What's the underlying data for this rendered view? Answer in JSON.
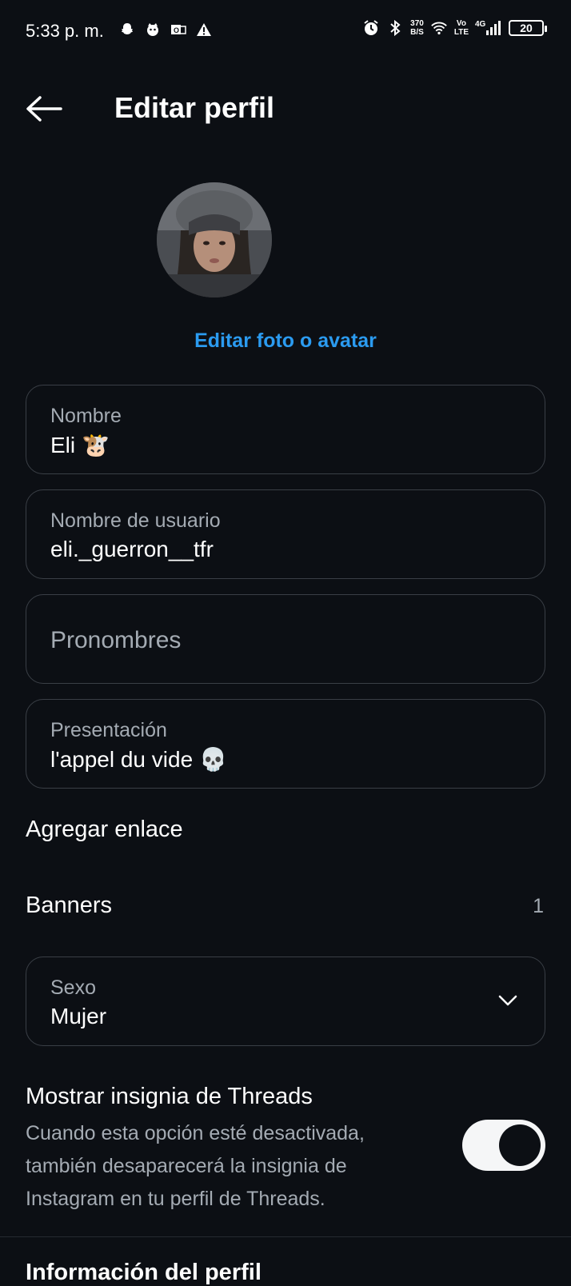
{
  "status_bar": {
    "time": "5:33 p. m.",
    "net_speed_value": "370",
    "net_speed_unit": "B/S",
    "volte_top": "Vo",
    "volte_bottom": "LTE",
    "network": "4G",
    "battery": "20",
    "left_icons": [
      "snapchat-icon",
      "cat-icon",
      "outlook-icon",
      "warning-icon"
    ],
    "right_icons": [
      "alarm-icon",
      "bluetooth-icon",
      "wifi-icon",
      "signal-icon"
    ]
  },
  "header": {
    "title": "Editar perfil",
    "back_icon": "arrow-left-icon"
  },
  "avatar": {
    "edit_label": "Editar foto o avatar"
  },
  "fields": {
    "name": {
      "label": "Nombre",
      "value": "Eli",
      "emoji": "🐮"
    },
    "username": {
      "label": "Nombre de usuario",
      "value": "eli._guerron__tfr"
    },
    "pronouns": {
      "placeholder": "Pronombres"
    },
    "bio": {
      "label": "Presentación",
      "value": "l'appel du vide",
      "emoji": "💀"
    }
  },
  "add_link": {
    "label": "Agregar enlace"
  },
  "banners": {
    "label": "Banners",
    "count": "1"
  },
  "gender": {
    "label": "Sexo",
    "value": "Mujer"
  },
  "threads_badge": {
    "title": "Mostrar insignia de Threads",
    "description": "Cuando esta opción esté desactivada, también desaparecerá la insignia de Instagram en tu perfil de Threads.",
    "enabled": true
  },
  "profile_info": {
    "label": "Información del perfil"
  }
}
